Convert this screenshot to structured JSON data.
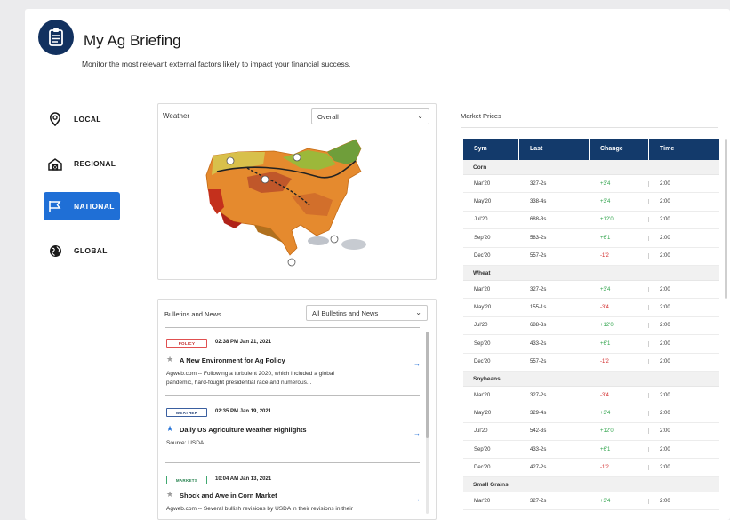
{
  "header": {
    "title": "My Ag Briefing",
    "subtitle": "Monitor the most relevant external factors likely to impact your financial success."
  },
  "nav": {
    "items": [
      {
        "label": "LOCAL",
        "icon": "location-pin-icon"
      },
      {
        "label": "REGIONAL",
        "icon": "barn-icon"
      },
      {
        "label": "NATIONAL",
        "icon": "flag-icon",
        "active": true
      },
      {
        "label": "GLOBAL",
        "icon": "globe-icon"
      }
    ]
  },
  "weather": {
    "label": "Weather",
    "select_value": "Overall"
  },
  "news": {
    "label": "Bulletins and News",
    "select_value": "All Bulletins and News",
    "items": [
      {
        "badge": "POLICY",
        "time": "02:38 PM Jan 21, 2021",
        "title": "A New Environment for Ag Policy",
        "desc_line1": "Agweb.com -- Following a turbulent 2020, which included a global",
        "desc_line2": "pandemic, hard-fought presidential race and numerous..."
      },
      {
        "badge": "WEATHER",
        "time": "02:35 PM Jan 19, 2021",
        "title": "Daily US Agriculture Weather Highlights",
        "desc_line1": "Source: USDA",
        "desc_line2": ""
      },
      {
        "badge": "MARKETS",
        "time": "10:04 AM Jan 13, 2021",
        "title": "Shock and Awe in Corn Market",
        "desc_line1": "Agweb.com -- Several bullish revisions by USDA in their revisions in their",
        "desc_line2": ""
      }
    ]
  },
  "market": {
    "label": "Market Prices",
    "headers": [
      "Sym",
      "Last",
      "Change",
      "Time"
    ],
    "groups": [
      {
        "name": "Corn",
        "rows": [
          {
            "sym": "Mar'20",
            "last": "327-2s",
            "change": "+3'4",
            "dir": "pos",
            "time": "2:00"
          },
          {
            "sym": "May'20",
            "last": "338-4s",
            "change": "+3'4",
            "dir": "pos",
            "time": "2:00"
          },
          {
            "sym": "Jul'20",
            "last": "688-3s",
            "change": "+12'0",
            "dir": "pos",
            "time": "2:00"
          },
          {
            "sym": "Sep'20",
            "last": "583-2s",
            "change": "+6'1",
            "dir": "pos",
            "time": "2:00"
          },
          {
            "sym": "Dec'20",
            "last": "557-2s",
            "change": "-1'2",
            "dir": "neg",
            "time": "2:00"
          }
        ]
      },
      {
        "name": "Wheat",
        "rows": [
          {
            "sym": "Mar'20",
            "last": "327-2s",
            "change": "+3'4",
            "dir": "pos",
            "time": "2:00"
          },
          {
            "sym": "May'20",
            "last": "155-1s",
            "change": "-3'4",
            "dir": "neg",
            "time": "2:00"
          },
          {
            "sym": "Jul'20",
            "last": "688-3s",
            "change": "+12'0",
            "dir": "pos",
            "time": "2:00"
          },
          {
            "sym": "Sep'20",
            "last": "433-2s",
            "change": "+6'1",
            "dir": "pos",
            "time": "2:00"
          },
          {
            "sym": "Dec'20",
            "last": "557-2s",
            "change": "-1'2",
            "dir": "neg",
            "time": "2:00"
          }
        ]
      },
      {
        "name": "Soybeans",
        "rows": [
          {
            "sym": "Mar'20",
            "last": "327-2s",
            "change": "-3'4",
            "dir": "neg",
            "time": "2:00"
          },
          {
            "sym": "May'20",
            "last": "329-4s",
            "change": "+3'4",
            "dir": "pos",
            "time": "2:00"
          },
          {
            "sym": "Jul'20",
            "last": "542-3s",
            "change": "+12'0",
            "dir": "pos",
            "time": "2:00"
          },
          {
            "sym": "Sep'20",
            "last": "433-2s",
            "change": "+6'1",
            "dir": "pos",
            "time": "2:00"
          },
          {
            "sym": "Dec'20",
            "last": "427-2s",
            "change": "-1'2",
            "dir": "neg",
            "time": "2:00"
          }
        ]
      },
      {
        "name": "Small Grains",
        "rows": [
          {
            "sym": "Mar'20",
            "last": "327-2s",
            "change": "+3'4",
            "dir": "pos",
            "time": "2:00"
          }
        ]
      }
    ]
  },
  "colors": {
    "brand_navy": "#12315f",
    "accent_blue": "#1f6fd6",
    "table_header": "#133a6b",
    "positive": "#2fa34b",
    "negative": "#d22b2b"
  }
}
